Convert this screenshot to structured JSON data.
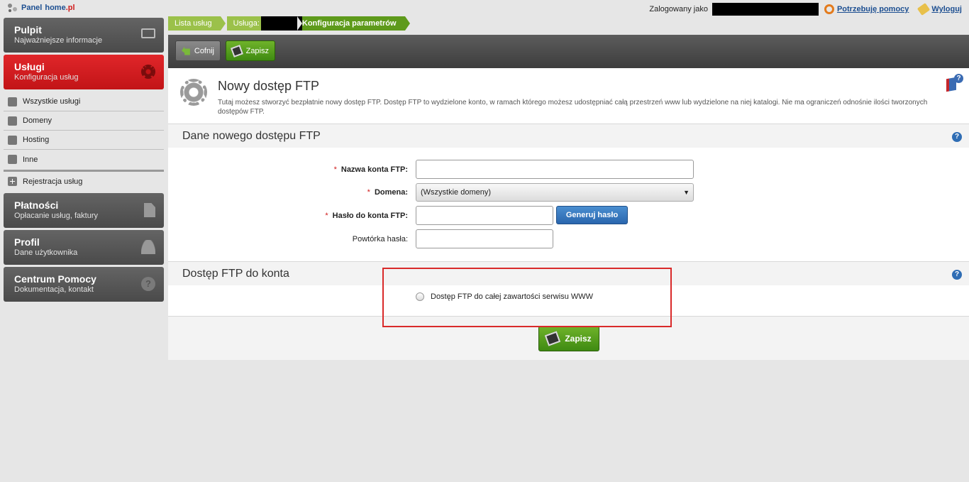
{
  "brand": {
    "part1": "Panel",
    "part2": "home",
    "part3": ".pl"
  },
  "topbar": {
    "logged_as": "Zalogowany jako",
    "help_link": "Potrzebuję pomocy",
    "logout_link": "Wyloguj"
  },
  "sidebar": {
    "pulpit": {
      "title": "Pulpit",
      "subtitle": "Najważniejsze informacje"
    },
    "uslugi": {
      "title": "Usługi",
      "subtitle": "Konfiguracja usług"
    },
    "sub_items": [
      "Wszystkie usługi",
      "Domeny",
      "Hosting",
      "Inne"
    ],
    "register": "Rejestracja usług",
    "platnosci": {
      "title": "Płatności",
      "subtitle": "Opłacanie usług, faktury"
    },
    "profil": {
      "title": "Profil",
      "subtitle": "Dane użytkownika"
    },
    "pomoc": {
      "title": "Centrum Pomocy",
      "subtitle": "Dokumentacja, kontakt"
    }
  },
  "breadcrumb": [
    "Lista usług",
    "Usługa:",
    "Konfiguracja parametrów"
  ],
  "toolbar": {
    "back_label": "Cofnij",
    "save_label": "Zapisz"
  },
  "page": {
    "title": "Nowy dostęp FTP",
    "description": "Tutaj możesz stworzyć bezpłatnie nowy dostęp FTP. Dostęp FTP to wydzielone konto, w ramach którego możesz udostępniać całą przestrzeń www lub wydzielone na niej katalogi. Nie ma ograniczeń odnośnie ilości tworzonych dostępów FTP."
  },
  "section1": {
    "title": "Dane nowego dostępu FTP",
    "fields": {
      "account_name": {
        "label": "Nazwa konta FTP:",
        "value": ""
      },
      "domain": {
        "label": "Domena:",
        "value": "(Wszystkie domeny)"
      },
      "password": {
        "label": "Hasło do konta FTP:",
        "value": ""
      },
      "password_repeat": {
        "label": "Powtórka hasła:",
        "value": ""
      }
    },
    "generate_button": "Generuj hasło",
    "required_mark": "*"
  },
  "section2": {
    "title": "Dostęp FTP do konta",
    "radio_label": "Dostęp FTP do całej zawartości serwisu WWW"
  },
  "save_button": "Zapisz",
  "help_mark": "?",
  "colors": {
    "accent_red": "#c21417",
    "accent_green": "#5e9a1b",
    "link_blue": "#1d4f91"
  }
}
